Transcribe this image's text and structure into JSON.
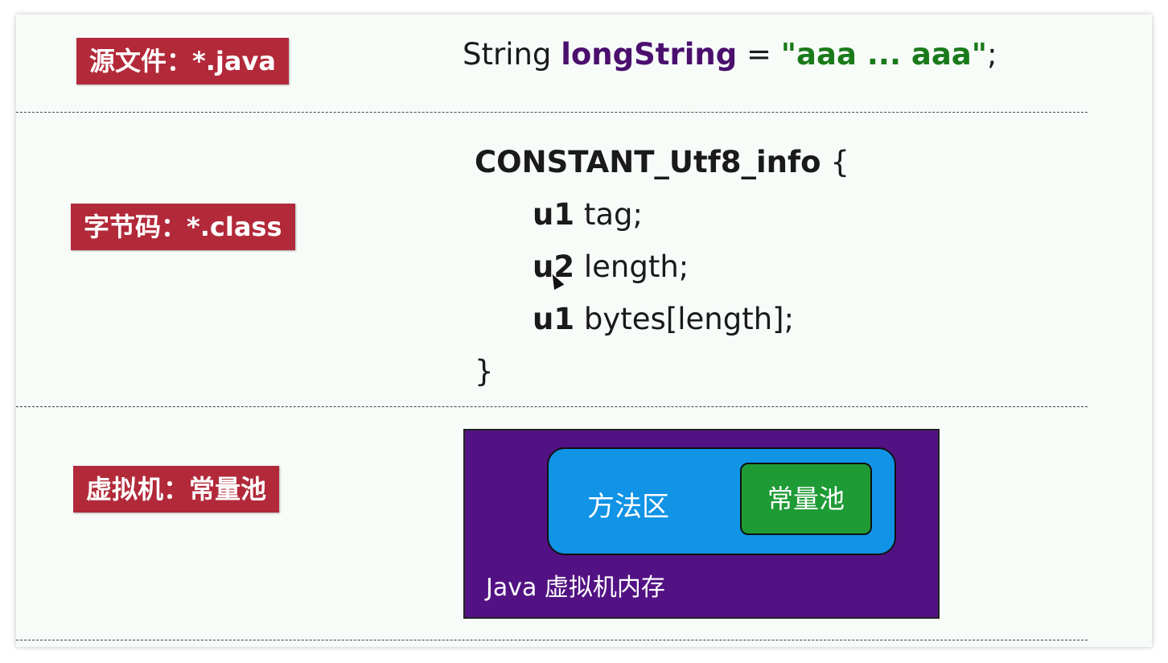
{
  "labels": {
    "source": "源文件：*.java",
    "bytecode": "字节码：*.class",
    "vm": "虚拟机：常量池"
  },
  "source_line": {
    "type": "String",
    "var": "longString",
    "eq": "=",
    "literal": "\"aaa ... aaa\"",
    "semi": ";"
  },
  "struct": {
    "name": "CONSTANT_Utf8_info",
    "open": "{",
    "close": "}",
    "fields": [
      {
        "type": "u1",
        "decl": "tag;"
      },
      {
        "type": "u2",
        "decl": "length;"
      },
      {
        "type": "u1",
        "decl": "bytes[length];"
      }
    ]
  },
  "memory": {
    "outer": "Java 虚拟机内存",
    "method_area": "方法区",
    "constant_pool": "常量池"
  },
  "colors": {
    "label_bg": "#b22a3a",
    "var": "#4b0f6e",
    "literal": "#1a7a1a",
    "vm_bg": "#521283",
    "method_area_bg": "#1193e6",
    "pool_bg": "#1e9b35"
  }
}
